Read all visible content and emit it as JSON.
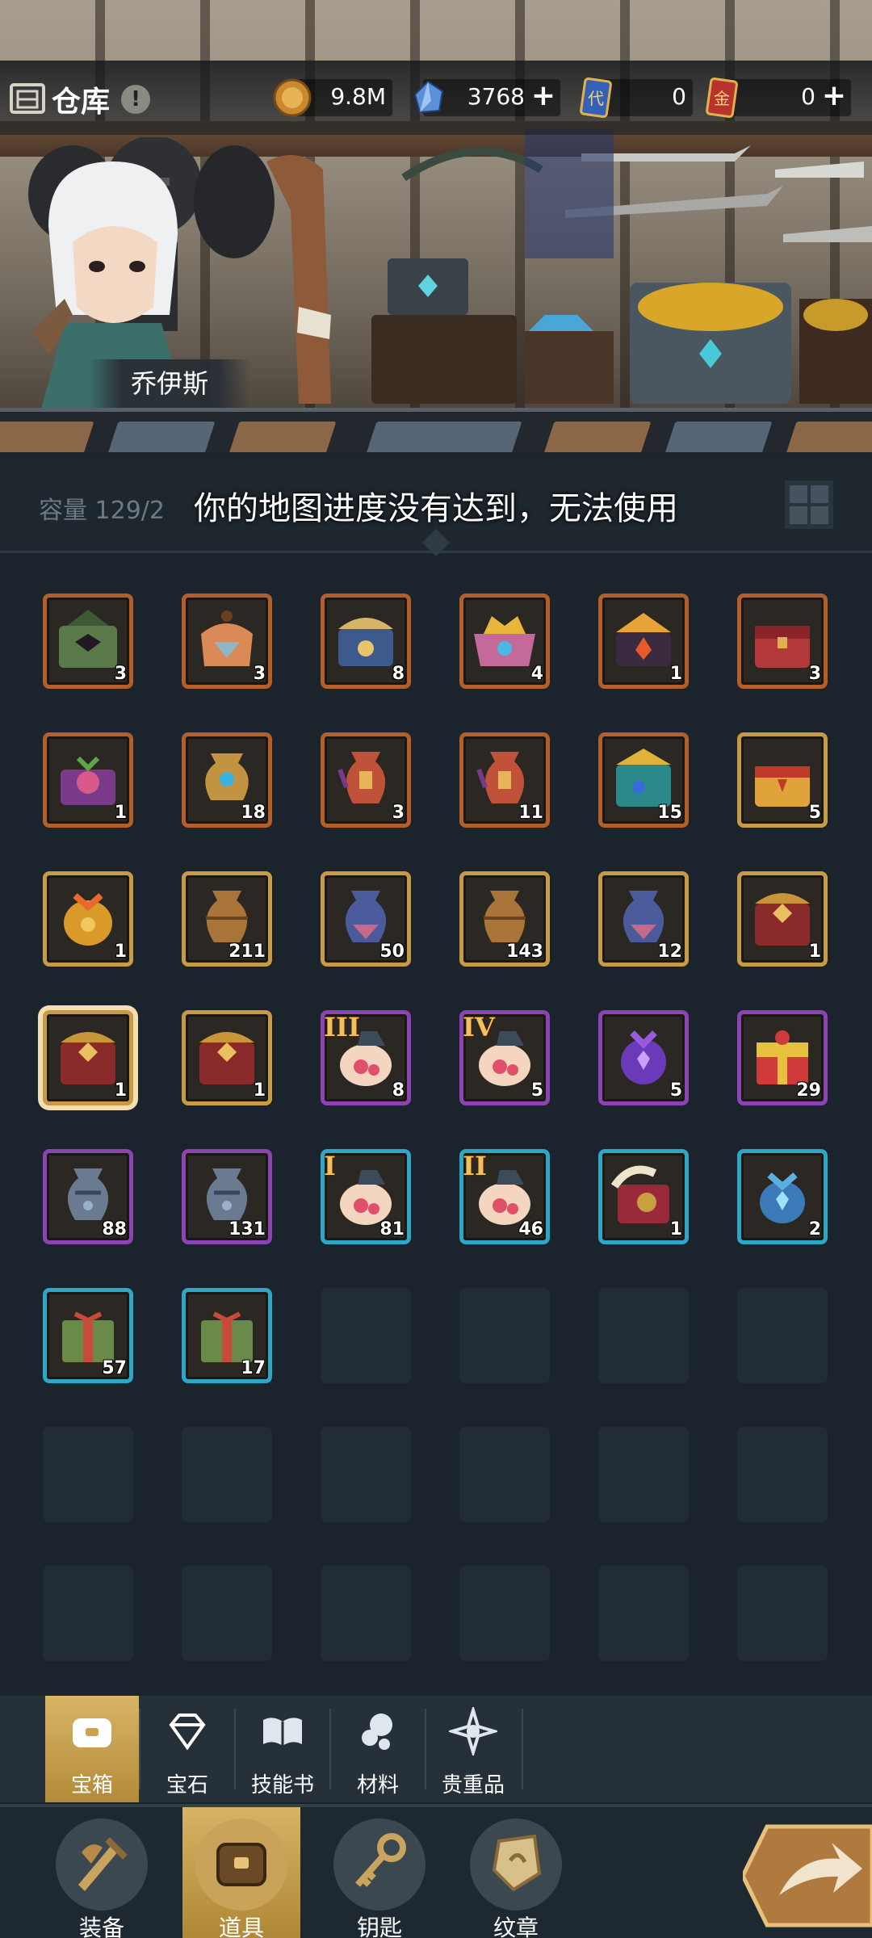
{
  "header": {
    "title": "仓库",
    "info_badge": "!",
    "resources": [
      {
        "name": "gold-coin",
        "value": "9.8M",
        "has_plus": false
      },
      {
        "name": "diamond",
        "value": "3768",
        "has_plus": true
      },
      {
        "name": "card-blue",
        "icon_text": "代",
        "value": "0",
        "has_plus": false
      },
      {
        "name": "card-red",
        "icon_text": "金",
        "value": "0",
        "has_plus": true
      }
    ],
    "hero_name": "乔伊斯"
  },
  "capacity": {
    "label": "容量 129/2"
  },
  "toast": {
    "message": "你的地图进度没有达到，无法使用"
  },
  "items": [
    {
      "icon": "green-bird-chest",
      "rarity": "orange",
      "count": "3"
    },
    {
      "icon": "bag-chest-orange",
      "rarity": "orange",
      "count": "3"
    },
    {
      "icon": "blue-gold-chest",
      "rarity": "orange",
      "count": "8"
    },
    {
      "icon": "crowned-pink-chest",
      "rarity": "orange",
      "count": "4"
    },
    {
      "icon": "flame-crown-chest",
      "rarity": "orange",
      "count": "1"
    },
    {
      "icon": "red-treasure-chest",
      "rarity": "orange",
      "count": "3"
    },
    {
      "icon": "purple-flower-chest",
      "rarity": "orange",
      "count": "1"
    },
    {
      "icon": "golden-urn-blue-gem",
      "rarity": "orange",
      "count": "18"
    },
    {
      "icon": "red-urn",
      "rarity": "orange",
      "count": "3"
    },
    {
      "icon": "red-urn",
      "rarity": "orange",
      "count": "11"
    },
    {
      "icon": "teal-gold-chest",
      "rarity": "orange",
      "count": "15"
    },
    {
      "icon": "golden-red-chest",
      "rarity": "gold",
      "count": "5"
    },
    {
      "icon": "honey-comb-pot",
      "rarity": "gold",
      "count": "1"
    },
    {
      "icon": "bronze-urn",
      "rarity": "gold",
      "count": "211"
    },
    {
      "icon": "blue-urn",
      "rarity": "gold",
      "count": "50"
    },
    {
      "icon": "bronze-urn",
      "rarity": "gold",
      "count": "143"
    },
    {
      "icon": "blue-urn",
      "rarity": "gold",
      "count": "12"
    },
    {
      "icon": "wooden-chest",
      "rarity": "gold",
      "count": "1"
    },
    {
      "icon": "wooden-chest",
      "rarity": "gold",
      "count": "1",
      "selected": true
    },
    {
      "icon": "wooden-chest",
      "rarity": "gold",
      "count": "1"
    },
    {
      "icon": "lucky-bag-pink",
      "rarity": "purple",
      "count": "8",
      "roman": "III"
    },
    {
      "icon": "lucky-bag-pink",
      "rarity": "purple",
      "count": "5",
      "roman": "IV"
    },
    {
      "icon": "purple-crystal-pot",
      "rarity": "purple",
      "count": "5"
    },
    {
      "icon": "red-gift-box",
      "rarity": "purple",
      "count": "29"
    },
    {
      "icon": "steel-urn",
      "rarity": "purple",
      "count": "88"
    },
    {
      "icon": "steel-urn",
      "rarity": "purple",
      "count": "131"
    },
    {
      "icon": "lucky-bag-pink",
      "rarity": "cyan",
      "count": "81",
      "roman": "I"
    },
    {
      "icon": "lucky-bag-pink",
      "rarity": "cyan",
      "count": "46",
      "roman": "II"
    },
    {
      "icon": "horn-chest",
      "rarity": "cyan",
      "count": "1"
    },
    {
      "icon": "blue-crystal-pot",
      "rarity": "cyan",
      "count": "2"
    },
    {
      "icon": "green-gift-box",
      "rarity": "cyan",
      "count": "57"
    },
    {
      "icon": "green-gift-box",
      "rarity": "cyan",
      "count": "17"
    }
  ],
  "empty_slots": 16,
  "category_tabs": [
    {
      "label": "宝箱",
      "icon": "chest-tab-icon",
      "active": true
    },
    {
      "label": "宝石",
      "icon": "gem-tab-icon",
      "active": false
    },
    {
      "label": "技能书",
      "icon": "book-tab-icon",
      "active": false
    },
    {
      "label": "材料",
      "icon": "material-tab-icon",
      "active": false
    },
    {
      "label": "贵重品",
      "icon": "valuable-tab-icon",
      "active": false
    }
  ],
  "bottom_nav": [
    {
      "label": "装备",
      "icon": "equipment-nav-icon",
      "active": false
    },
    {
      "label": "道具",
      "icon": "item-nav-icon",
      "active": true
    },
    {
      "label": "钥匙",
      "icon": "key-nav-icon",
      "active": false
    },
    {
      "label": "纹章",
      "icon": "emblem-nav-icon",
      "active": false
    }
  ],
  "back_button": {
    "icon": "return-arrow-icon"
  },
  "colors": {
    "orange": "#b45e2a",
    "gold": "#c79a45",
    "purple": "#8c44b4",
    "cyan": "#2ea7c6",
    "active_tab": "#c9a34f"
  }
}
